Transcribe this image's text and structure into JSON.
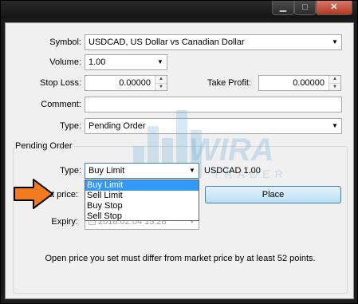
{
  "window": {
    "minimize_icon": "minimize-icon",
    "maximize_icon": "maximize-icon",
    "close_icon": "close-icon"
  },
  "form": {
    "symbol": {
      "label": "Symbol:",
      "value": "USDCAD, US Dollar vs Canadian Dollar"
    },
    "volume": {
      "label": "Volume:",
      "value": "1.00"
    },
    "stop_loss": {
      "label": "Stop Loss:",
      "value": "0.00000"
    },
    "take_profit": {
      "label": "Take Profit:",
      "value": "0.00000"
    },
    "comment": {
      "label": "Comment:",
      "value": ""
    },
    "type": {
      "label": "Type:",
      "value": "Pending Order"
    }
  },
  "pending_order": {
    "group_title": "Pending Order",
    "type_label": "Type:",
    "type_value": "Buy Limit",
    "symbol_volume": "USDCAD 1.00",
    "type_options": [
      "Buy Limit",
      "Sell Limit",
      "Buy Stop",
      "Sell Stop"
    ],
    "at_price_label": "at price:",
    "place_button": "Place",
    "expiry_label": "Expiry:",
    "expiry_value": "2018.02.04 13:28"
  },
  "message": "Open price you set must differ from market price by at least 52 points.",
  "watermark": {
    "brand": "WIRA",
    "sub": "TRADER"
  },
  "annotation": {
    "arrow_color": "#f47a20"
  }
}
